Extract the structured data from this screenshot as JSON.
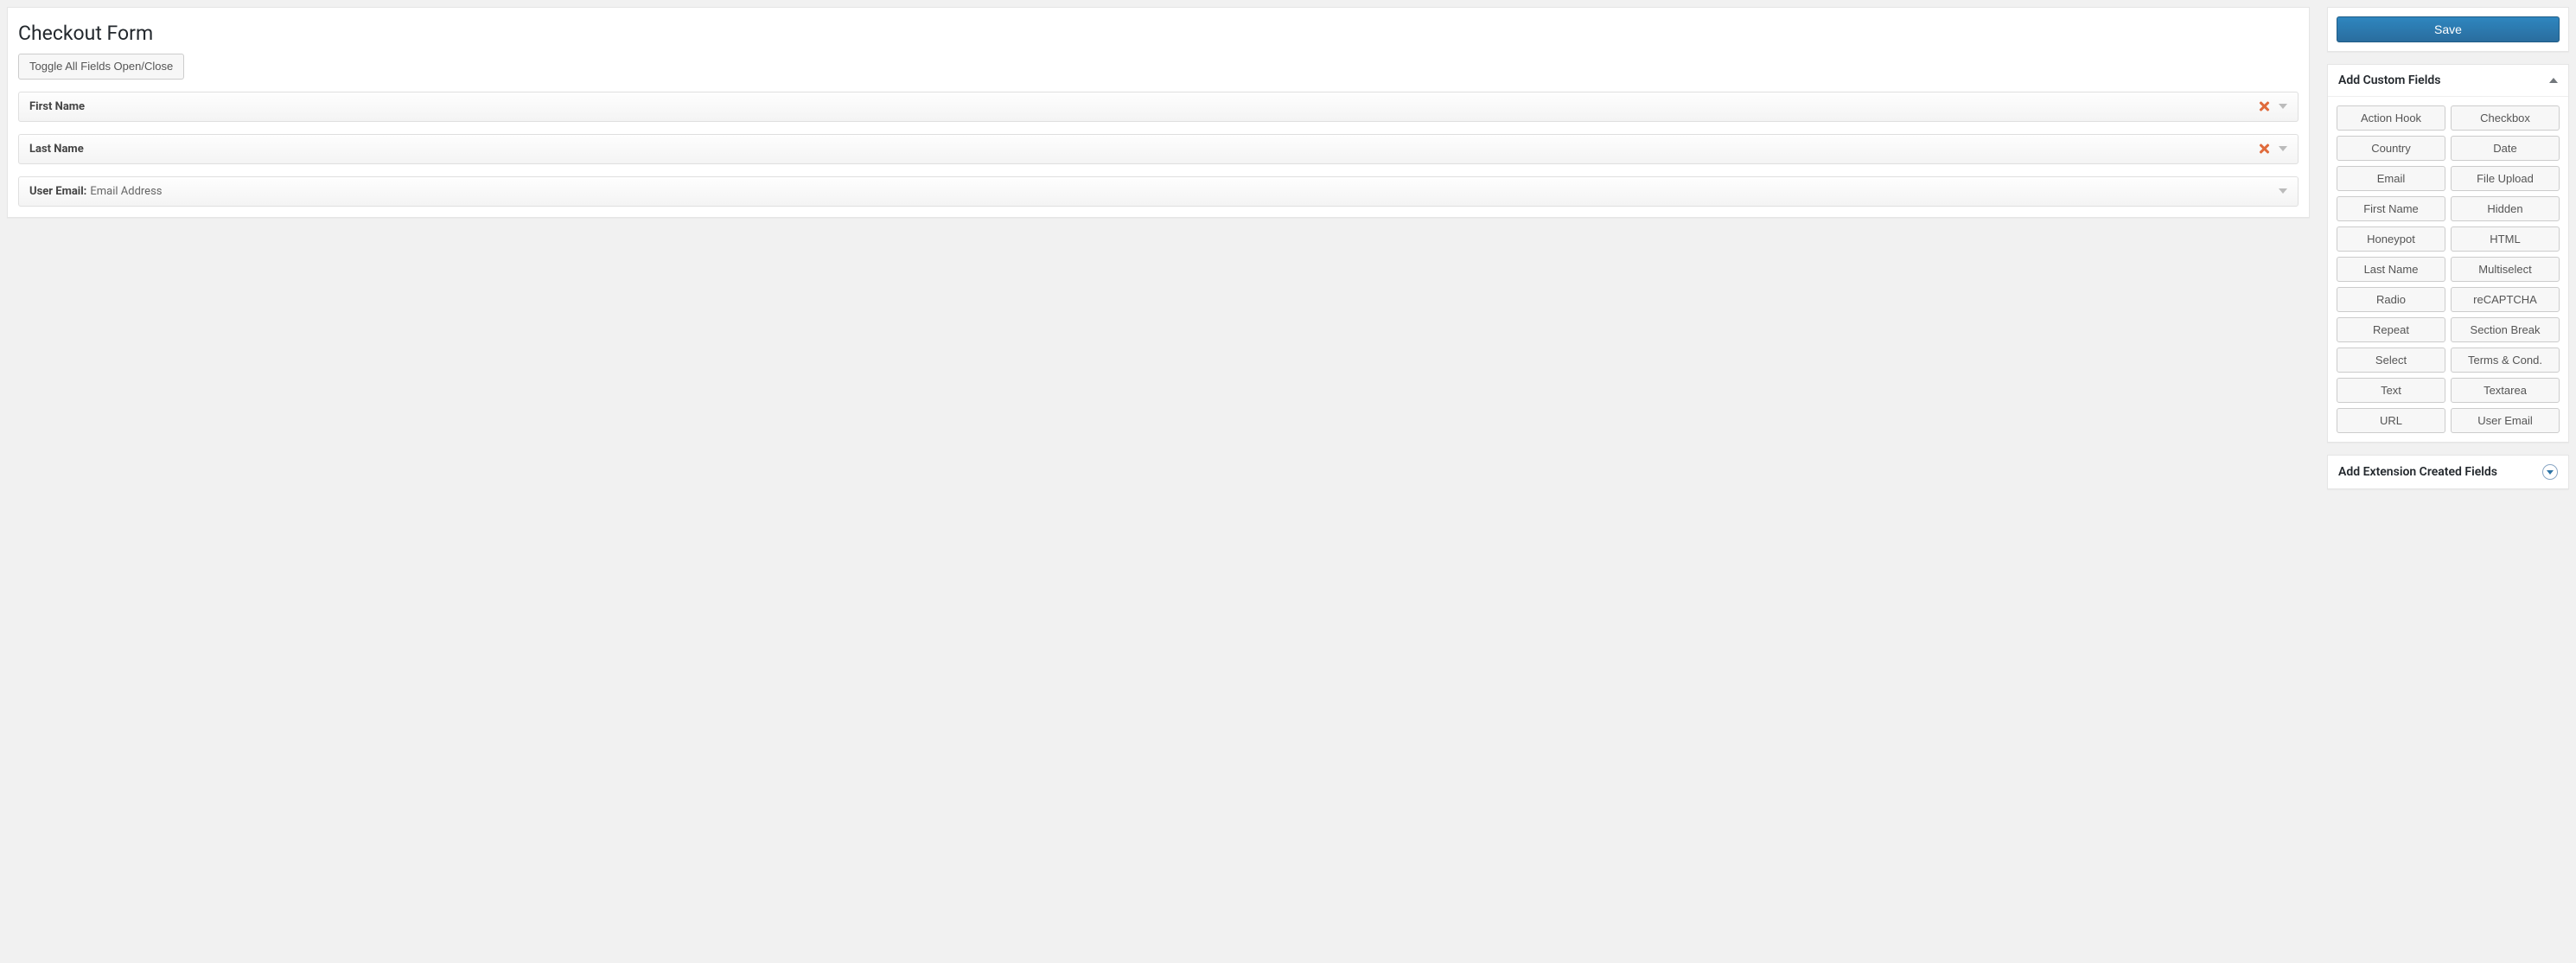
{
  "main": {
    "title": "Checkout Form",
    "toggle_button": "Toggle All Fields Open/Close",
    "fields": [
      {
        "label": "First Name",
        "suffix": "",
        "deletable": true
      },
      {
        "label": "Last Name",
        "suffix": "",
        "deletable": true
      },
      {
        "label": "User Email:",
        "suffix": "Email Address",
        "deletable": false
      }
    ]
  },
  "sidebar": {
    "save_label": "Save",
    "add_custom_title": "Add Custom Fields",
    "custom_fields": [
      "Action Hook",
      "Checkbox",
      "Country",
      "Date",
      "Email",
      "File Upload",
      "First Name",
      "Hidden",
      "Honeypot",
      "HTML",
      "Last Name",
      "Multiselect",
      "Radio",
      "reCAPTCHA",
      "Repeat",
      "Section Break",
      "Select",
      "Terms & Cond.",
      "Text",
      "Textarea",
      "URL",
      "User Email"
    ],
    "add_ext_title": "Add Extension Created Fields"
  },
  "colors": {
    "primary": "#2e74a6",
    "delete_icon": "#e06b3c"
  }
}
